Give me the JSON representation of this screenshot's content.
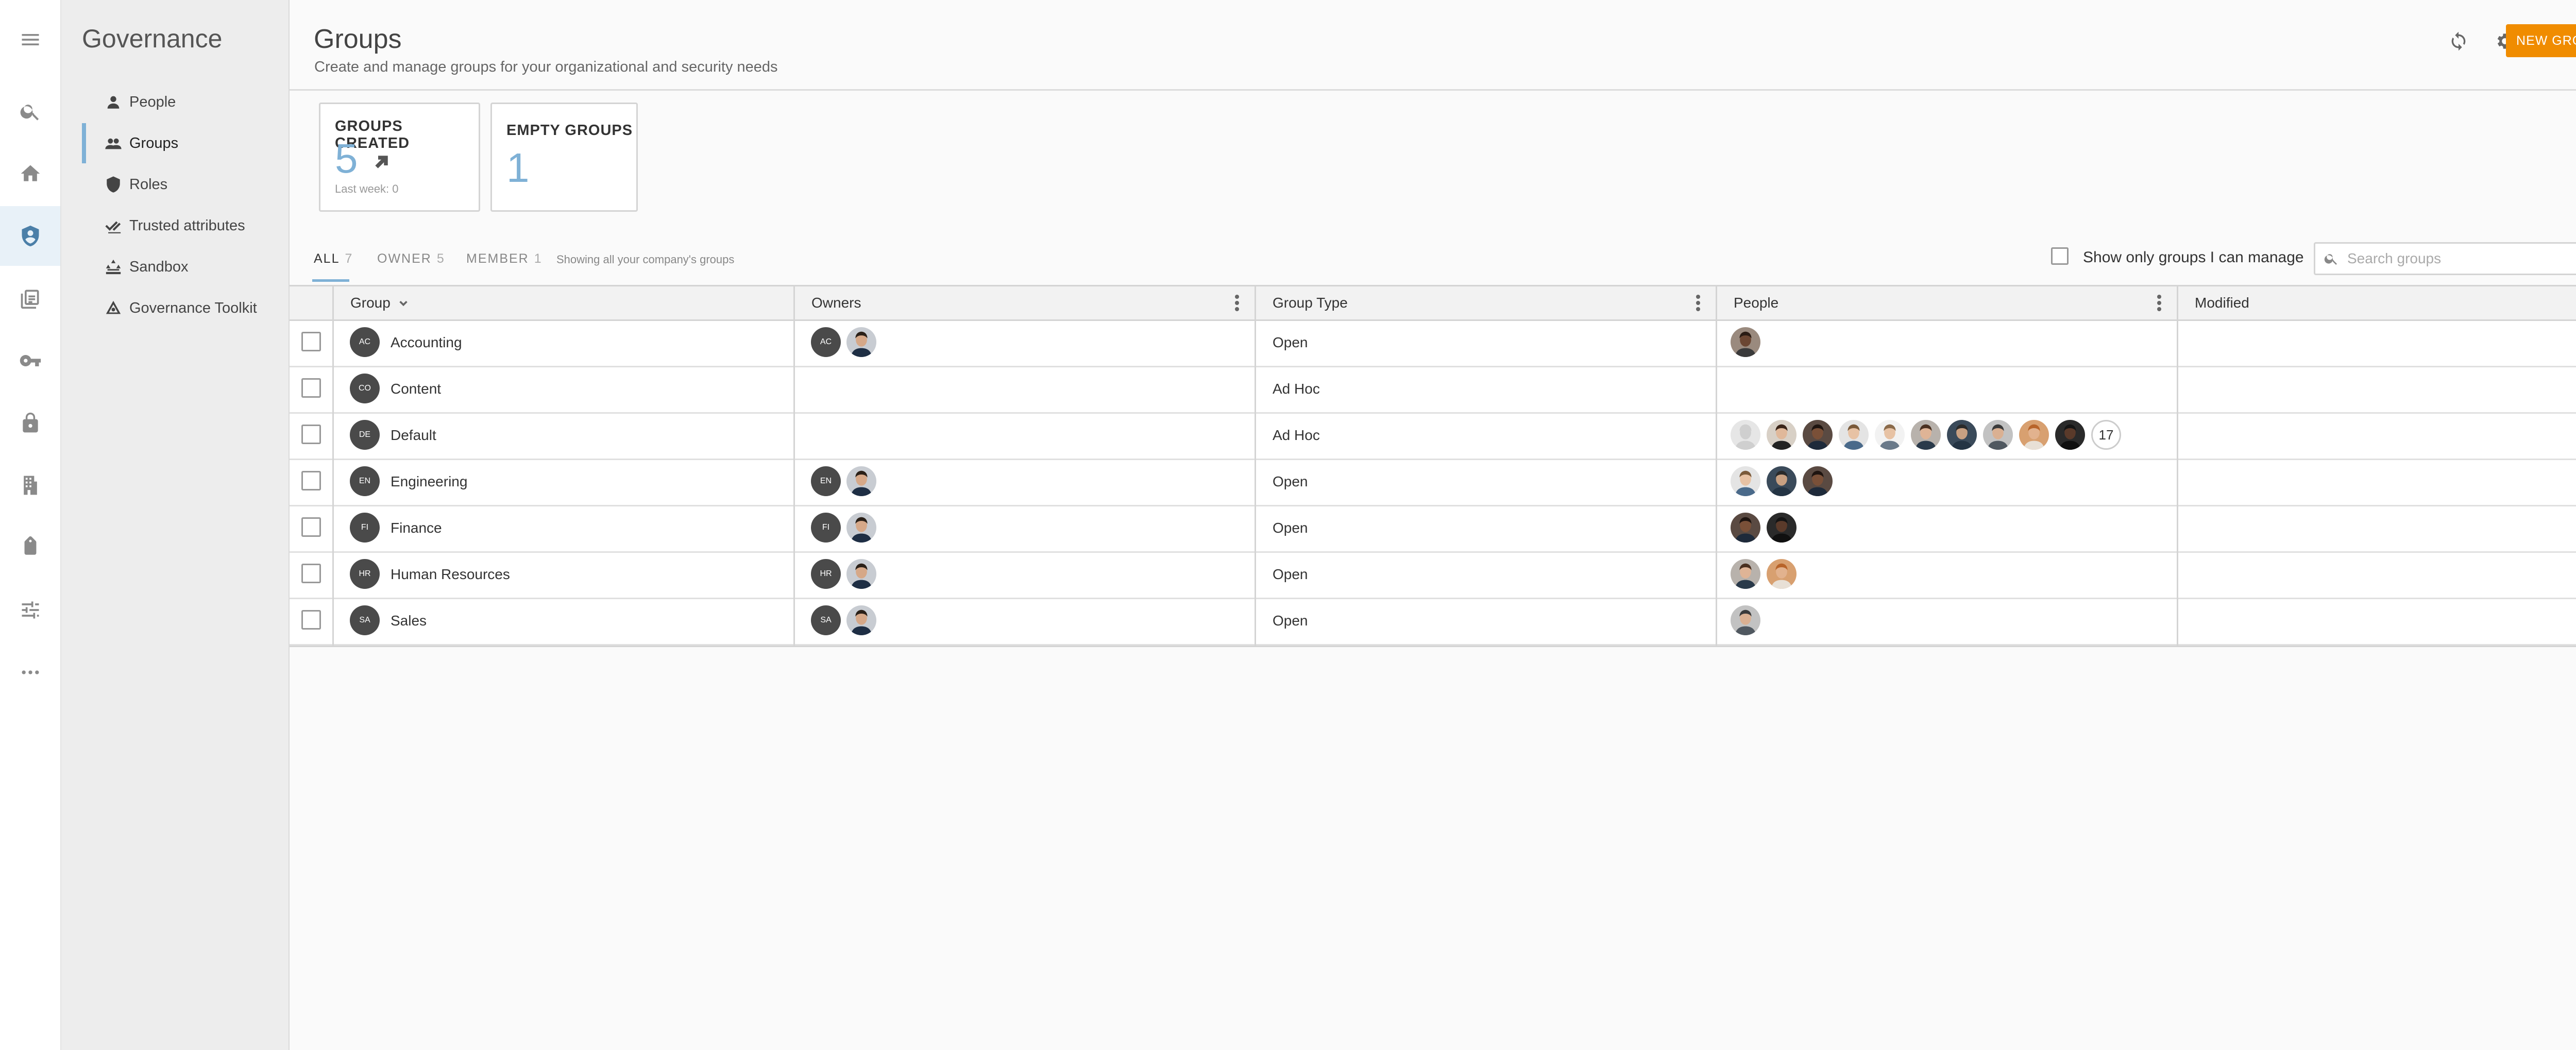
{
  "rail": [
    {
      "name": "menu-icon",
      "icon": "menu"
    },
    {
      "name": "search-icon",
      "icon": "search"
    },
    {
      "name": "home-icon",
      "icon": "home"
    },
    {
      "name": "governance-shield-icon",
      "icon": "shield",
      "active": true
    },
    {
      "name": "reports-icon",
      "icon": "reports"
    },
    {
      "name": "key-icon",
      "icon": "key"
    },
    {
      "name": "lock-icon",
      "icon": "lock"
    },
    {
      "name": "building-icon",
      "icon": "building"
    },
    {
      "name": "tag-icon",
      "icon": "tag"
    },
    {
      "name": "settings-sliders-icon",
      "icon": "sliders"
    },
    {
      "name": "more-icon",
      "icon": "more"
    }
  ],
  "subnav": {
    "title": "Governance",
    "items": [
      {
        "label": "People",
        "icon": "person-icon"
      },
      {
        "label": "Groups",
        "icon": "people-icon",
        "active": true
      },
      {
        "label": "Roles",
        "icon": "shield-icon"
      },
      {
        "label": "Trusted attributes",
        "icon": "checks-icon"
      },
      {
        "label": "Sandbox",
        "icon": "sandbox-icon"
      },
      {
        "label": "Governance Toolkit",
        "icon": "toolkit-icon"
      }
    ]
  },
  "header": {
    "title": "Groups",
    "subtitle": "Create and manage groups for your organizational and security needs",
    "new_button": "NEW GROUP",
    "refresh_icon": "refresh-icon",
    "settings_icon": "gear-icon"
  },
  "cards": {
    "created": {
      "label": "GROUPS CREATED",
      "value": "5",
      "footnote": "Last week: 0",
      "trend_icon": "arrow-up-right-icon"
    },
    "empty": {
      "label": "EMPTY GROUPS",
      "value": "1"
    }
  },
  "tabs": [
    {
      "label": "ALL",
      "count": "7",
      "active": true
    },
    {
      "label": "OWNER",
      "count": "5"
    },
    {
      "label": "MEMBER",
      "count": "1"
    }
  ],
  "tab_note": "Showing all your company's groups",
  "filter": {
    "manage_label": "Show only groups I can manage",
    "search_placeholder": "Search groups"
  },
  "table": {
    "columns": [
      "Group",
      "Owners",
      "Group Type",
      "People",
      "Modified"
    ],
    "rows": [
      {
        "initials": "AC",
        "name": "Accounting",
        "owner_initials": "AC",
        "owner_photo": true,
        "type": "Open",
        "people": [
          "p1"
        ],
        "more": ""
      },
      {
        "initials": "CO",
        "name": "Content",
        "owner_initials": "",
        "owner_photo": false,
        "type": "Ad Hoc",
        "people": [],
        "more": ""
      },
      {
        "initials": "DE",
        "name": "Default",
        "owner_initials": "",
        "owner_photo": false,
        "type": "Ad Hoc",
        "people": [
          "p0",
          "p2",
          "p3",
          "p4",
          "p5",
          "p6",
          "p7",
          "p8",
          "p9",
          "p10"
        ],
        "more": "17"
      },
      {
        "initials": "EN",
        "name": "Engineering",
        "owner_initials": "EN",
        "owner_photo": true,
        "type": "Open",
        "people": [
          "p4",
          "p7",
          "p3"
        ],
        "more": ""
      },
      {
        "initials": "FI",
        "name": "Finance",
        "owner_initials": "FI",
        "owner_photo": true,
        "type": "Open",
        "people": [
          "p3",
          "p10"
        ],
        "more": ""
      },
      {
        "initials": "HR",
        "name": "Human Resources",
        "owner_initials": "HR",
        "owner_photo": true,
        "type": "Open",
        "people": [
          "p6",
          "p9"
        ],
        "more": ""
      },
      {
        "initials": "SA",
        "name": "Sales",
        "owner_initials": "SA",
        "owner_photo": true,
        "type": "Open",
        "people": [
          "p8"
        ],
        "more": ""
      }
    ]
  },
  "colors": {
    "accent": "#7fb1d6",
    "primary_button": "#f08c00",
    "avatar_bg": "#4a4a4a"
  }
}
